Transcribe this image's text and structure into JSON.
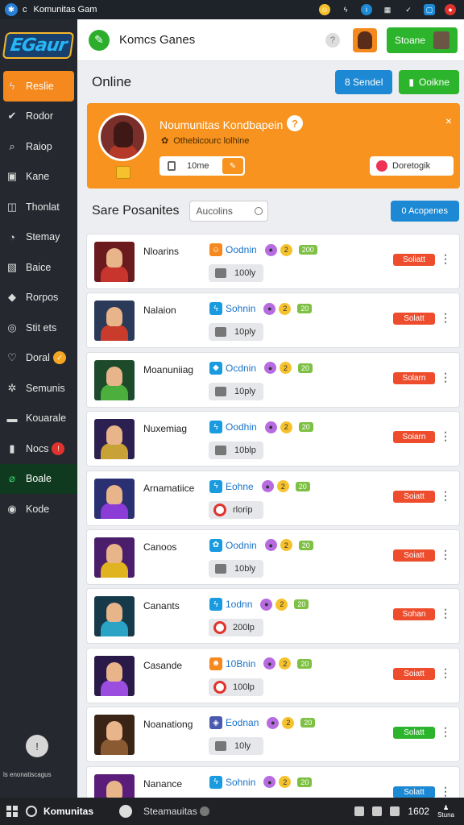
{
  "window": {
    "title": "Komunitas Gam",
    "app_letter": "c"
  },
  "sidebar": {
    "items": [
      {
        "label": "Reslie",
        "icon": "bolt-icon",
        "state": "active"
      },
      {
        "label": "Rodor",
        "icon": "check-icon"
      },
      {
        "label": "Raiop",
        "icon": "search-icon"
      },
      {
        "label": "Kane",
        "icon": "grid-icon"
      },
      {
        "label": "Thonlat",
        "icon": "square-icon"
      },
      {
        "label": "Stemay",
        "icon": "chat-icon"
      },
      {
        "label": "Baice",
        "icon": "image-icon"
      },
      {
        "label": "Rorpos",
        "icon": "tag-icon"
      },
      {
        "label": "Stit ets",
        "icon": "target-icon"
      },
      {
        "label": "Doral",
        "icon": "heart-icon",
        "badge": "✓",
        "badge_color": "#f5a623"
      },
      {
        "label": "Semunis",
        "icon": "gear-icon"
      },
      {
        "label": "Kouarale",
        "icon": "box-icon"
      },
      {
        "label": "Nocs",
        "icon": "bookmark-icon",
        "badge": "!",
        "badge_color": "#e0332d"
      },
      {
        "label": "Boale",
        "icon": "link-icon",
        "state": "selected"
      },
      {
        "label": "Kode",
        "icon": "eye-icon"
      }
    ],
    "footer_caption": "ls enonatiscagus"
  },
  "header": {
    "title": "Komcs Ganes",
    "button_label": "Stoane"
  },
  "online": {
    "title": "Online",
    "btn1": "8 Sendel",
    "btn2": "Ooikne",
    "btn1_color": "#1d89d4",
    "btn2_color": "#2cb52c"
  },
  "promo": {
    "title": "Noumunitas Kondbapein",
    "subtitle": "Othebicourc lolhine",
    "input_value": "10me",
    "button_label": "Doretogik",
    "close": "×",
    "help": "?"
  },
  "section": {
    "title": "Sare Posanites",
    "filter": "Aucolins",
    "button_label": "0 Acopenes"
  },
  "games": [
    {
      "name": "Nloarins",
      "stat": "Oodnin",
      "c1": "2",
      "lvl": "200",
      "pill": "100ly",
      "pill_type": "grey",
      "btn": "Soliatt",
      "btn_color": "#ee4d2d",
      "thumb_bg": "#6b1b1e",
      "thumb_fig": "#c8352c",
      "stat_icon_bg": "#f5891e",
      "stat_icon": "☺"
    },
    {
      "name": "Nalaion",
      "stat": "Sohnin",
      "c1": "2",
      "lvl": "20",
      "pill": "10ply",
      "pill_type": "grey",
      "btn": "Solatt",
      "btn_color": "#ee4d2d",
      "thumb_bg": "#2a3a58",
      "thumb_fig": "#c93b2a",
      "stat_icon_bg": "#1a9be0",
      "stat_icon": "ϟ"
    },
    {
      "name": "Moanuniiag",
      "stat": "Ocdnin",
      "c1": "2",
      "lvl": "20",
      "pill": "10ply",
      "pill_type": "grey",
      "btn": "Solarn",
      "btn_color": "#ee4d2d",
      "thumb_bg": "#1c4a2a",
      "thumb_fig": "#4cae3c",
      "stat_icon_bg": "#1a9be0",
      "stat_icon": "◆"
    },
    {
      "name": "Nuxemiag",
      "stat": "Oodhin",
      "c1": "2",
      "lvl": "20",
      "pill": "10blp",
      "pill_type": "grey",
      "btn": "Soiarn",
      "btn_color": "#ee4d2d",
      "thumb_bg": "#2b2050",
      "thumb_fig": "#c8a236",
      "stat_icon_bg": "#1a9be0",
      "stat_icon": "ϟ"
    },
    {
      "name": "Arnamatiice",
      "stat": "Eohne",
      "c1": "2",
      "lvl": "20",
      "pill": "rlorip",
      "pill_type": "red",
      "btn": "Soiatt",
      "btn_color": "#ee4d2d",
      "thumb_bg": "#2a3072",
      "thumb_fig": "#8b3bd6",
      "stat_icon_bg": "#1a9be0",
      "stat_icon": "ϟ"
    },
    {
      "name": "Canoos",
      "stat": "Oodnin",
      "c1": "2",
      "lvl": "20",
      "pill": "10bly",
      "pill_type": "grey",
      "btn": "Soiatt",
      "btn_color": "#ee4d2d",
      "thumb_bg": "#4a1e6a",
      "thumb_fig": "#e0b321",
      "stat_icon_bg": "#1a9be0",
      "stat_icon": "✿"
    },
    {
      "name": "Canants",
      "stat": "1odnn",
      "c1": "2",
      "lvl": "20",
      "pill": "200lp",
      "pill_type": "red",
      "btn": "Sohan",
      "btn_color": "#ee4d2d",
      "thumb_bg": "#163a4a",
      "thumb_fig": "#2aa3c4",
      "stat_icon_bg": "#1a9be0",
      "stat_icon": "ϟ"
    },
    {
      "name": "Casande",
      "stat": "10Bnin",
      "c1": "2",
      "lvl": "20",
      "pill": "100lp",
      "pill_type": "red",
      "btn": "Soiatt",
      "btn_color": "#ee4d2d",
      "thumb_bg": "#2a1a4a",
      "thumb_fig": "#9b4de0",
      "stat_icon_bg": "#f5891e",
      "stat_icon": "☻"
    },
    {
      "name": "Noanationg",
      "stat": "Eodnan",
      "c1": "2",
      "lvl": "20",
      "pill": "10ly",
      "pill_type": "grey",
      "btn": "Solatt",
      "btn_color": "#2cb52c",
      "thumb_bg": "#3a2416",
      "thumb_fig": "#8a5a32",
      "stat_icon_bg": "#4a5ab0",
      "stat_icon": "◈"
    },
    {
      "name": "Nanance",
      "stat": "Sohnin",
      "c1": "2",
      "lvl": "20",
      "pill": "",
      "pill_type": "none",
      "btn": "Solatt",
      "btn_color": "#1d89d4",
      "thumb_bg": "#5a1e7a",
      "thumb_fig": "#2cb52c",
      "stat_icon_bg": "#1a9be0",
      "stat_icon": "ϟ"
    }
  ],
  "taskbar": {
    "app1": "Komunitas",
    "app2": "Steamauitas",
    "time": "1602",
    "notif": "Stuna"
  }
}
